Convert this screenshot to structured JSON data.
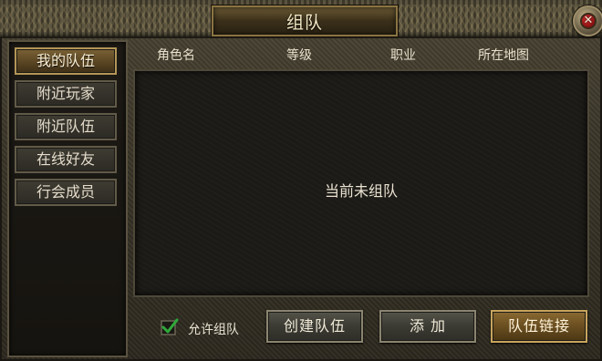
{
  "window": {
    "title": "组队",
    "close_symbol": "✕"
  },
  "sidebar": {
    "items": [
      {
        "label": "我的队伍",
        "active": true
      },
      {
        "label": "附近玩家",
        "active": false
      },
      {
        "label": "附近队伍",
        "active": false
      },
      {
        "label": "在线好友",
        "active": false
      },
      {
        "label": "行会成员",
        "active": false
      }
    ]
  },
  "table": {
    "columns": [
      "角色名",
      "等级",
      "职业",
      "所在地图"
    ],
    "empty_message": "当前未组队"
  },
  "footer": {
    "allow_team_label": "允许组队",
    "allow_team_checked": true,
    "create_button": "创建队伍",
    "add_button": "添 加",
    "link_button": "队伍链接"
  },
  "colors": {
    "accent_gold": "#b39556",
    "checkmark_green": "#2fa83a"
  },
  "icons": {
    "close": "close-icon",
    "check": "check-icon"
  }
}
